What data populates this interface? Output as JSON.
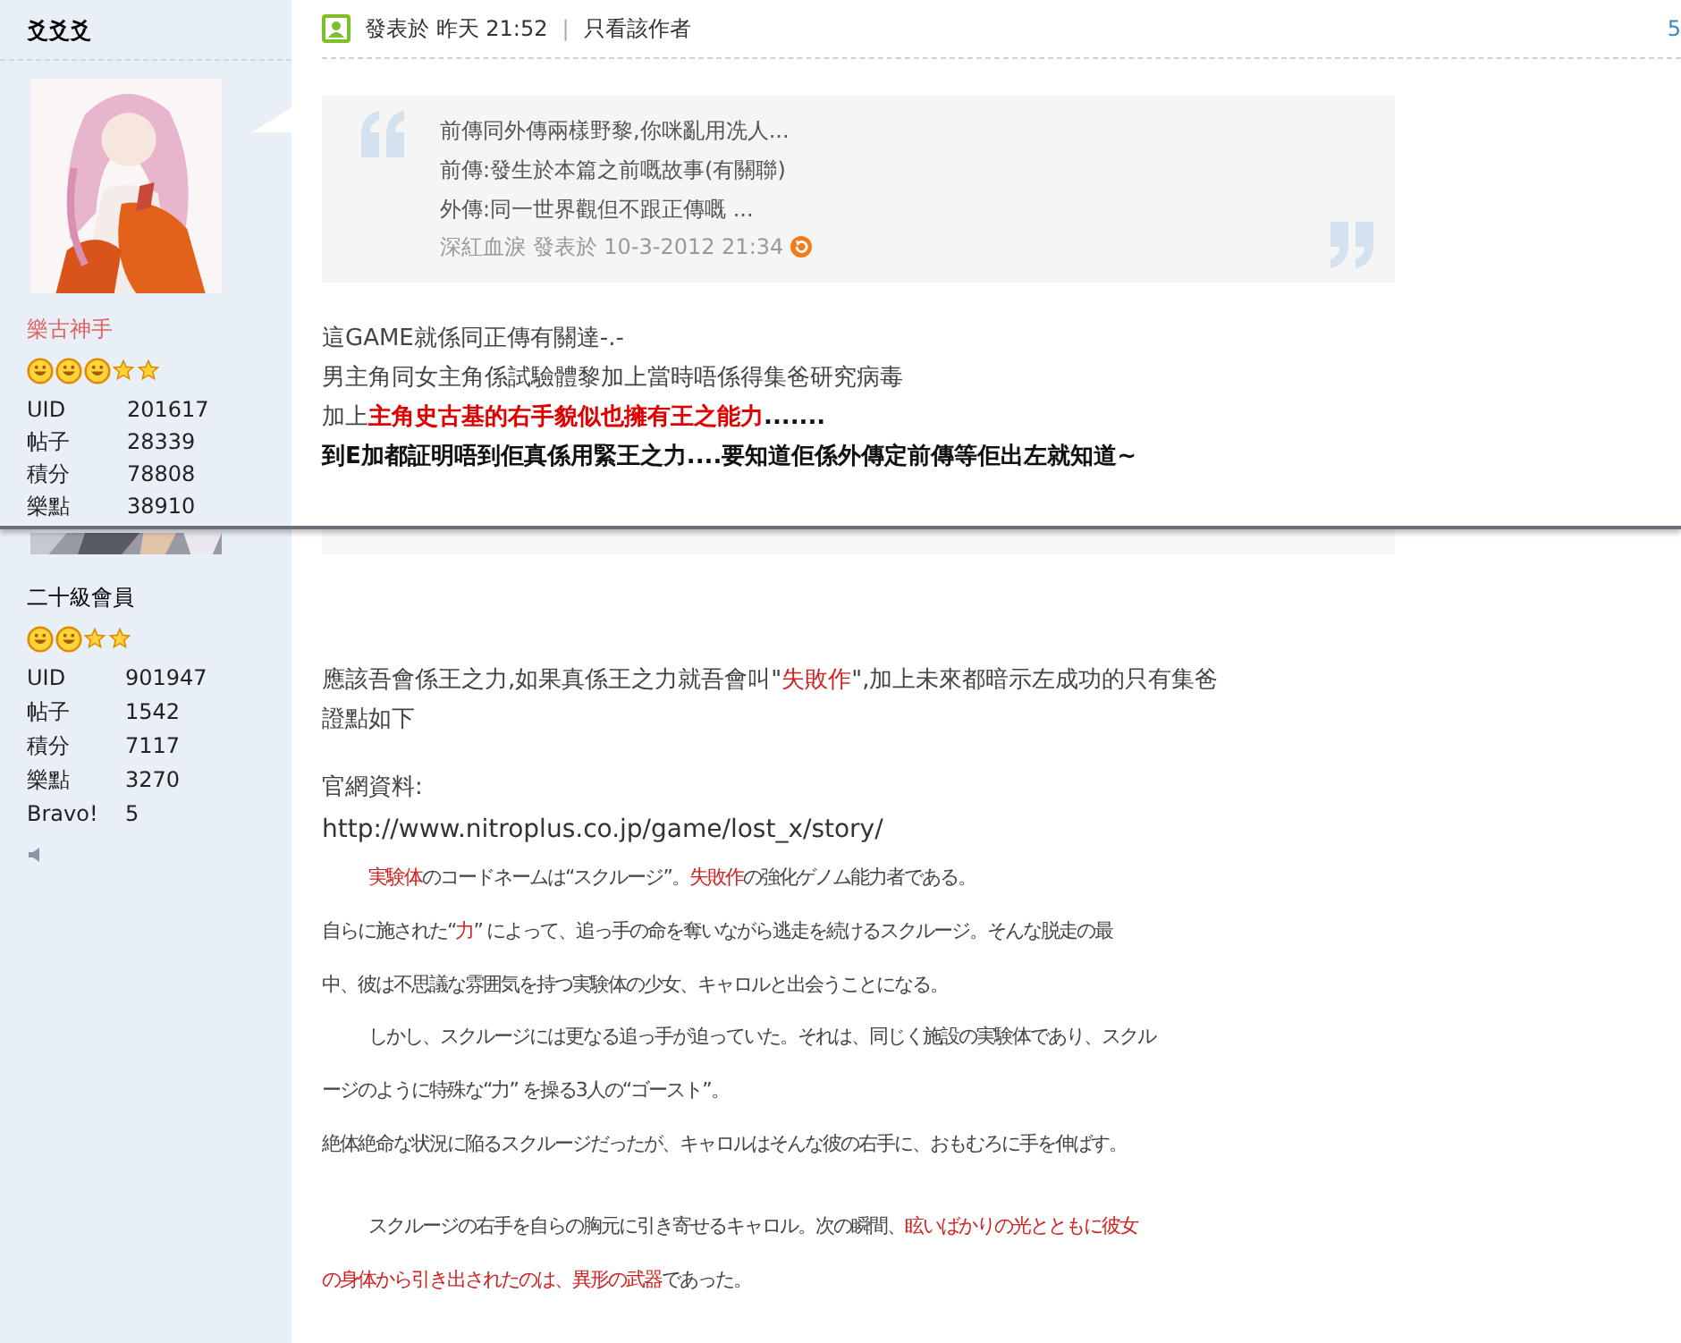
{
  "posts": [
    {
      "author": "爻爻爻",
      "rank": "樂古神手",
      "rank_highlight": true,
      "rank_icons": [
        {
          "kind": "smiley"
        },
        {
          "kind": "smiley"
        },
        {
          "kind": "smiley"
        },
        {
          "kind": "star"
        },
        {
          "kind": "star"
        }
      ],
      "stats": [
        {
          "label": "UID",
          "value": "201617"
        },
        {
          "label": "帖子",
          "value": "28339"
        },
        {
          "label": "積分",
          "value": "78808"
        },
        {
          "label": "樂點",
          "value": "38910"
        }
      ],
      "header": {
        "posted": "發表於 昨天 21:52",
        "separator": "|",
        "author_only": "只看該作者",
        "floor": "5"
      },
      "quote": {
        "lines": [
          "前傳同外傳兩樣野黎,你咪亂用冼人...",
          "前傳:發生於本篇之前嘅故事(有關聯)",
          "外傳:同一世界觀但不跟正傳嘅 ..."
        ],
        "byline": "深紅血淚 發表於 10-3-2012 21:34"
      },
      "body": [
        {
          "kind": "text",
          "segments": [
            {
              "text": "這GAME就係同正傳有關達-.-",
              "red": false,
              "bold": false
            }
          ]
        },
        {
          "kind": "text",
          "segments": [
            {
              "text": "男主角同女主角係試驗體黎加上當時唔係得集爸研究病毒",
              "red": false,
              "bold": false
            }
          ]
        },
        {
          "kind": "text",
          "segments": [
            {
              "text": "加上",
              "red": false,
              "bold": false
            },
            {
              "text": "主角史古基的右手貌似也擁有王之能力",
              "red": true,
              "bold": true
            },
            {
              "text": ".......",
              "red": false,
              "bold": true
            }
          ]
        },
        {
          "kind": "text",
          "segments": [
            {
              "text": "到E加都証明唔到佢真係用緊王之力....要知道佢係外傳定前傳等佢出左就知道~",
              "red": false,
              "bold": true
            }
          ]
        }
      ]
    },
    {
      "rank": "二十級會員",
      "rank_highlight": false,
      "rank_icons": [
        {
          "kind": "smiley"
        },
        {
          "kind": "smiley"
        },
        {
          "kind": "star"
        },
        {
          "kind": "star"
        }
      ],
      "stats": [
        {
          "label": "UID",
          "value": "901947"
        },
        {
          "label": "帖子",
          "value": "1542"
        },
        {
          "label": "積分",
          "value": "7117"
        },
        {
          "label": "樂點",
          "value": "3270"
        },
        {
          "label": "Bravo!",
          "value": "5"
        }
      ],
      "body": [
        {
          "kind": "text",
          "segments": [
            {
              "text": "應該吾會係王之力,如果真係王之力就吾會叫\"",
              "red": false,
              "bold": false
            },
            {
              "text": "失敗作",
              "red": true,
              "bold": false
            },
            {
              "text": "\",加上未來都暗示左成功的只有集爸",
              "red": false,
              "bold": false
            }
          ]
        },
        {
          "kind": "text",
          "segments": [
            {
              "text": "證點如下",
              "red": false,
              "bold": false
            }
          ]
        },
        {
          "kind": "blank"
        },
        {
          "kind": "text",
          "segments": [
            {
              "text": "官網資料:",
              "red": false,
              "bold": false
            }
          ]
        },
        {
          "kind": "link",
          "segments": [
            {
              "text": "http://www.nitroplus.co.jp/game/lost_x/story/",
              "red": false,
              "bold": false
            }
          ]
        },
        {
          "kind": "story",
          "indent": true,
          "segments": [
            {
              "text": "実験体",
              "red": true,
              "bold": false
            },
            {
              "text": "のコードネームは“スクルージ”。",
              "red": false,
              "bold": false
            },
            {
              "text": "失敗作",
              "red": true,
              "bold": false
            },
            {
              "text": "の強化ゲノム能力者である。",
              "red": false,
              "bold": false
            }
          ]
        },
        {
          "kind": "story",
          "indent": false,
          "segments": [
            {
              "text": "自らに施された“",
              "red": false,
              "bold": false
            },
            {
              "text": "力",
              "red": true,
              "bold": false
            },
            {
              "text": "” によって、追っ手の命を奪いながら逃走を続けるスクルージ。そんな脱走の最",
              "red": false,
              "bold": false
            }
          ]
        },
        {
          "kind": "story",
          "indent": false,
          "segments": [
            {
              "text": "中、彼は不思議な雰囲気を持つ実験体の少女、キャロルと出会うことになる。",
              "red": false,
              "bold": false
            }
          ]
        },
        {
          "kind": "story",
          "indent": true,
          "segments": [
            {
              "text": "しかし、スクルージには更なる追っ手が迫っていた。それは、同じく施設の実験体であり、スクル",
              "red": false,
              "bold": false
            }
          ]
        },
        {
          "kind": "story",
          "indent": false,
          "segments": [
            {
              "text": "ージのように特殊な“力” を操る3人の“ゴースト”。",
              "red": false,
              "bold": false
            }
          ]
        },
        {
          "kind": "story",
          "indent": false,
          "segments": [
            {
              "text": "絶体絶命な状況に陥るスクルージだったが、キャロルはそんな彼の右手に、おもむろに手を伸ばす。",
              "red": false,
              "bold": false
            }
          ]
        },
        {
          "kind": "blank"
        },
        {
          "kind": "story",
          "indent": true,
          "segments": [
            {
              "text": "スクルージの右手を自らの胸元に引き寄せるキャロル。次の瞬間、",
              "red": false,
              "bold": false
            },
            {
              "text": "眩いばかりの光とともに彼女",
              "red": true,
              "bold": false
            }
          ]
        },
        {
          "kind": "story",
          "indent": false,
          "segments": [
            {
              "text": "の身体から引き出されたのは、異形の武器",
              "red": true,
              "bold": false
            },
            {
              "text": "であった。",
              "red": false,
              "bold": false
            }
          ]
        }
      ]
    }
  ]
}
